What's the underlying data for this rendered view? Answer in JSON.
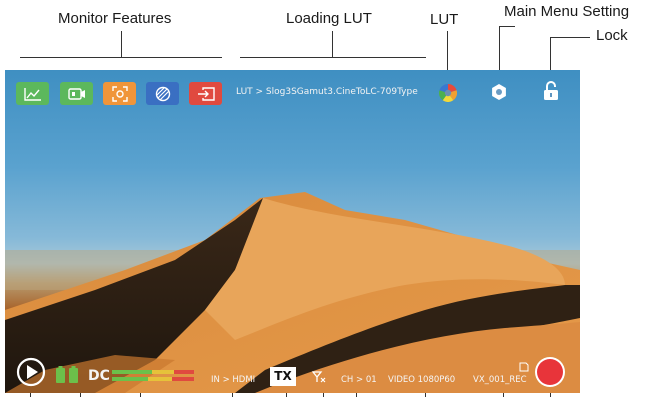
{
  "callouts": {
    "monitor_features": "Monitor Features",
    "loading_lut": "Loading LUT",
    "lut": "LUT",
    "main_menu_setting": "Main Menu Setting",
    "lock": "Lock"
  },
  "topbar": {
    "lut_path": "LUT > Slog3SGamut3.CineToLC-709Type",
    "feature_icons": [
      {
        "icon": "waveform-icon",
        "color": "#5cb85c"
      },
      {
        "icon": "video-icon",
        "color": "#5cb85c"
      },
      {
        "icon": "focus-icon",
        "color": "#f0953a"
      },
      {
        "icon": "zebra-icon",
        "color": "#3a6fc2"
      },
      {
        "icon": "input-icon",
        "color": "#e04a3f"
      }
    ]
  },
  "bottombar": {
    "power_source": "DC",
    "input": "IN > HDMI",
    "tx": "TX",
    "channel": "CH > 01",
    "video_format": "VIDEO 1080P60",
    "record_name": "VX_001_REC"
  },
  "colors": {
    "record_button": "#e8343a",
    "battery": "#6cc04a"
  }
}
